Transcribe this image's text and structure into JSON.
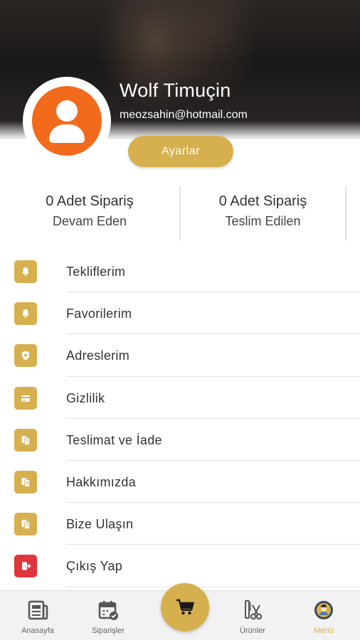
{
  "profile": {
    "name": "Wolf Timuçin",
    "email": "meozsahin@hotmail.com",
    "settings_label": "Ayarlar"
  },
  "stats": [
    {
      "count": "0 Adet Sipariş",
      "label": "Devam Eden"
    },
    {
      "count": "0 Adet Sipariş",
      "label": "Teslim Edilen"
    }
  ],
  "menu": {
    "items": [
      {
        "label": "Tekliflerim",
        "icon": "bell-icon"
      },
      {
        "label": "Favorilerim",
        "icon": "bell-icon"
      },
      {
        "label": "Adreslerim",
        "icon": "shield-icon"
      },
      {
        "label": "Gizlilik",
        "icon": "card-icon"
      },
      {
        "label": "Teslimat ve İade",
        "icon": "document-icon"
      },
      {
        "label": "Hakkımızda",
        "icon": "document-icon"
      },
      {
        "label": "Bize Ulaşın",
        "icon": "document-icon"
      },
      {
        "label": "Çıkış Yap",
        "icon": "logout-icon"
      }
    ]
  },
  "nav": {
    "home": "Anasayfa",
    "orders": "Siparişler",
    "products": "Ürünler",
    "menu": "Menü"
  },
  "colors": {
    "accent": "#d6b04e",
    "avatar": "#f26a1b",
    "logout": "#e0353b"
  }
}
